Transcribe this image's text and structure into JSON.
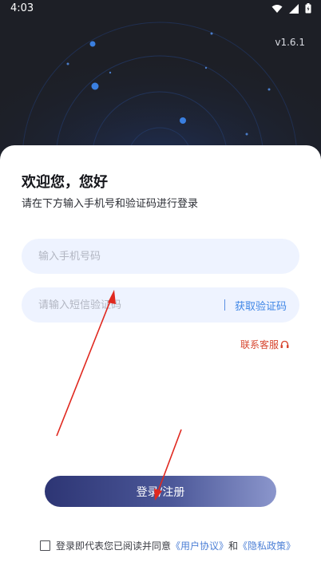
{
  "status_bar": {
    "time": "4:03"
  },
  "header": {
    "version": "v1.6.1"
  },
  "welcome": {
    "title": "欢迎您，您好",
    "subtitle": "请在下方输入手机号和验证码进行登录"
  },
  "form": {
    "phone_placeholder": "输入手机号码",
    "code_placeholder": "请输入短信验证码",
    "get_code_label": "获取验证码",
    "contact_label": "联系客服",
    "login_label": "登录/注册"
  },
  "agreement": {
    "prefix": "登录即代表您已阅读并同意",
    "user_agreement": "《用户协议》",
    "and": "和",
    "privacy_policy": "《隐私政策》"
  },
  "colors": {
    "hero_bg": "#1d1f26",
    "accent": "#3f86e6",
    "contact": "#d7462f",
    "annotation": "#e0281f"
  }
}
